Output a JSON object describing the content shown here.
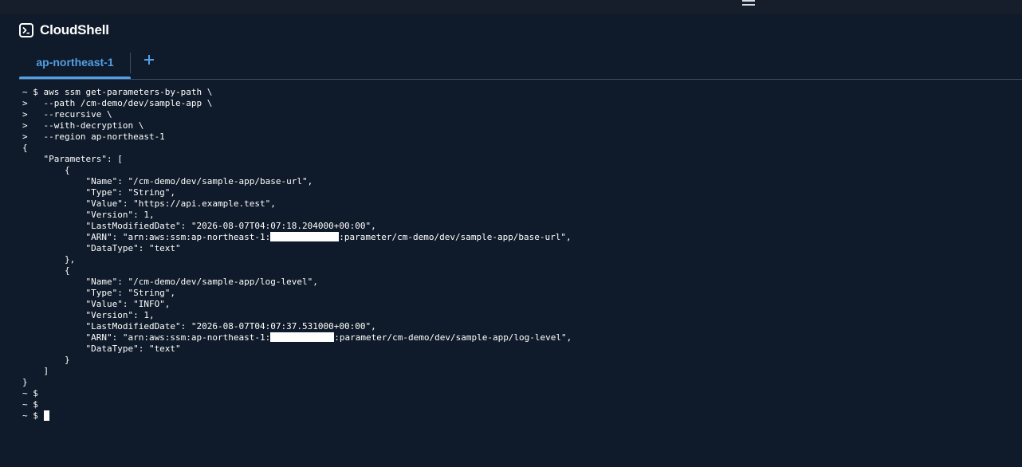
{
  "header": {
    "title": "CloudShell",
    "shell_icon": "terminal-prompt-icon",
    "menu_icon": "hamburger-menu-icon"
  },
  "tabs": [
    {
      "label": "ap-northeast-1",
      "active": true
    }
  ],
  "add_tab_icon": "plus-icon",
  "colors": {
    "background": "#0f1b2a",
    "accent": "#539fe5",
    "text": "#ffffff"
  },
  "terminal": {
    "lines": [
      "~ $ aws ssm get-parameters-by-path \\",
      ">   --path /cm-demo/dev/sample-app \\",
      ">   --recursive \\",
      ">   --with-decryption \\",
      ">   --region ap-northeast-1",
      "{",
      "    \"Parameters\": [",
      "        {",
      "            \"Name\": \"/cm-demo/dev/sample-app/base-url\",",
      "            \"Type\": \"String\",",
      "            \"Value\": \"https://api.example.test\",",
      "            \"Version\": 1,",
      "            \"LastModifiedDate\": \"2026-08-07T04:07:18.204000+00:00\",",
      {
        "before": "            \"ARN\": \"arn:aws:ssm:ap-northeast-1:",
        "after": ":parameter/cm-demo/dev/sample-app/base-url\","
      },
      "            \"DataType\": \"text\"",
      "        },",
      "        {",
      "            \"Name\": \"/cm-demo/dev/sample-app/log-level\",",
      "            \"Type\": \"String\",",
      "            \"Value\": \"INFO\",",
      "            \"Version\": 1,",
      "            \"LastModifiedDate\": \"2026-08-07T04:07:37.531000+00:00\",",
      {
        "before": "            \"ARN\": \"arn:aws:ssm:ap-northeast-1:",
        "after": ":parameter/cm-demo/dev/sample-app/log-level\","
      },
      "            \"DataType\": \"text\"",
      "        }",
      "    ]",
      "}",
      "~ $",
      "~ $",
      "~ $ "
    ]
  }
}
